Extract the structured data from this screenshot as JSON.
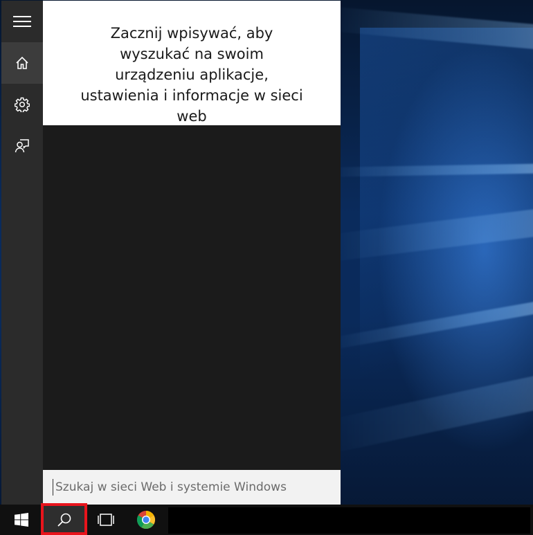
{
  "cortana": {
    "hint_text": "Zacznij wpisywać, aby wyszukać na swoim urządzeniu aplikacje, ustawienia i informacje w sieci web",
    "search_placeholder": "Szukaj w sieci Web i systemie Windows",
    "search_value": ""
  },
  "sidebar": {
    "items": [
      {
        "icon": "hamburger-menu-icon"
      },
      {
        "icon": "home-icon",
        "active": true
      },
      {
        "icon": "gear-icon"
      },
      {
        "icon": "feedback-icon"
      }
    ]
  },
  "taskbar": {
    "items": [
      {
        "icon": "windows-logo-icon"
      },
      {
        "icon": "search-icon",
        "highlighted": true
      },
      {
        "icon": "task-view-icon"
      },
      {
        "icon": "chrome-icon"
      }
    ]
  },
  "colors": {
    "highlight": "#e8141c",
    "panel_bg": "#1b1b1b",
    "sidebar_bg": "#2b2b2b",
    "taskbar_bg": "#101010"
  }
}
